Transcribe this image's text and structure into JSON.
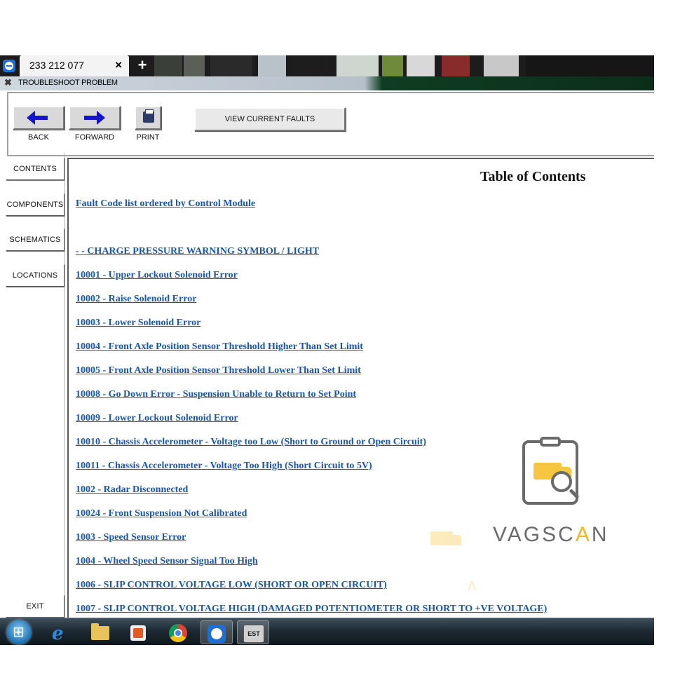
{
  "session_tab": {
    "title": "233 212 077",
    "close_glyph": "×",
    "new_tab_glyph": "+"
  },
  "window": {
    "title": "TROUBLESHOOT PROBLEM",
    "close_glyph": "✖"
  },
  "toolbar": {
    "back_label": "BACK",
    "forward_label": "FORWARD",
    "print_label": "PRINT",
    "view_faults_label": "VIEW CURRENT FAULTS"
  },
  "nav": {
    "contents": "CONTENTS",
    "components": "COMPONENTS",
    "schematics": "SCHEMATICS",
    "locations": "LOCATIONS",
    "exit": "EXIT"
  },
  "main": {
    "title": "Table of Contents",
    "intro_link": "Fault Code list ordered by Control Module",
    "links": [
      "- - CHARGE PRESSURE WARNING SYMBOL / LIGHT",
      "10001 - Upper Lockout Solenoid Error",
      "10002 - Raise Solenoid Error",
      "10003 - Lower Solenoid Error",
      "10004 - Front Axle Position Sensor Threshold Higher Than Set Limit",
      "10005 - Front Axle Position Sensor Threshold Lower Than Set Limit",
      "10008 - Go Down Error - Suspension Unable to Return to Set Point",
      "10009 - Lower Lockout Solenoid Error",
      "10010 - Chassis Accelerometer - Voltage too Low (Short to Ground or Open Circuit)",
      "10011 - Chassis Accelerometer - Voltage Too High (Short Circuit to 5V)",
      "1002 - Radar Disconnected",
      "10024 - Front Suspension Not Calibrated",
      "1003 - Speed Sensor Error",
      "1004 - Wheel Speed Sensor Signal Too High",
      "1006 - SLIP CONTROL VOLTAGE LOW (SHORT OR OPEN CIRCUIT)",
      "1007 - SLIP CONTROL VOLTAGE HIGH (DAMAGED POTENTIOMETER OR SHORT TO +VE VOLTAGE)"
    ]
  },
  "watermark": {
    "text_a": "VAGSC",
    "text_accent": "A",
    "text_b": "N",
    "ghost_glyph": "Λ"
  },
  "taskbar": {
    "items": [
      "start-orb",
      "internet-explorer-icon",
      "file-explorer-icon",
      "media-player-icon",
      "chrome-icon",
      "teamviewer-icon",
      "est-icon"
    ],
    "est_label": "EST"
  },
  "colors": {
    "link": "#1a57a8",
    "accent": "#f1b824",
    "arrow": "#1414c8"
  }
}
